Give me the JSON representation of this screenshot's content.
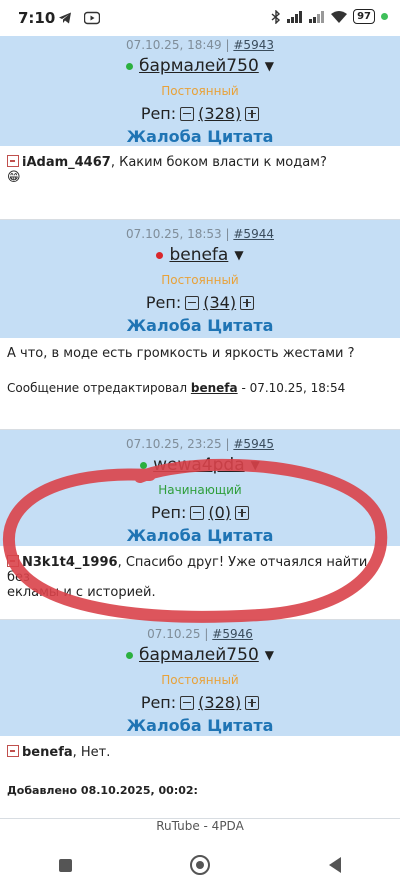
{
  "status_bar": {
    "time": "7:10",
    "battery": "97"
  },
  "posts": [
    {
      "date": "07.10.25, 18:49",
      "sep": "|",
      "num": "#5943",
      "user": "бармалей750",
      "status": "Постоянный",
      "status_color": "#e8a23a",
      "rep_label": "Реп:",
      "rep": "(328)",
      "actions": "Жалоба Цитата",
      "quote_user": "iAdam_4467",
      "text": ", Каким боком власти к модам?",
      "emoji": "😁"
    },
    {
      "date": "07.10.25, 18:53",
      "sep": "|",
      "num": "#5944",
      "user": "benefa",
      "status": "Постоянный",
      "status_color": "#e8a23a",
      "rep_label": "Реп:",
      "rep": "(34)",
      "actions": "Жалоба Цитата",
      "text": "А что, в моде есть громкость и яркость жестами ?",
      "edit_prefix": "Сообщение отредактировал ",
      "edit_user": "benefa",
      "edit_suffix": " - 07.10.25, 18:54"
    },
    {
      "date": "07.10.25, 23:25",
      "sep": "|",
      "num": "#5945",
      "user": "wewa4pda",
      "status": "Начинающий",
      "status_color": "#2e9e3a",
      "rep_label": "Реп:",
      "rep": "(0)",
      "actions": "Жалоба Цитата",
      "quote_user": "N3k1t4_1996",
      "text": ", Спасибо друг! Уже отчаялся найти без",
      "text2": "екламы и с историей."
    },
    {
      "date": "07.10.25",
      "sep": "|",
      "num": "#5946",
      "user": "бармалей750",
      "status": "Постоянный",
      "status_color": "#e8a23a",
      "rep_label": "Реп:",
      "rep": "(328)",
      "actions": "Жалоба Цитата",
      "quote_user": "benefa",
      "text": ", Нет.",
      "added": "Добавлено 08.10.2025, 00:02:"
    }
  ],
  "page_title": "RuTube - 4PDA"
}
